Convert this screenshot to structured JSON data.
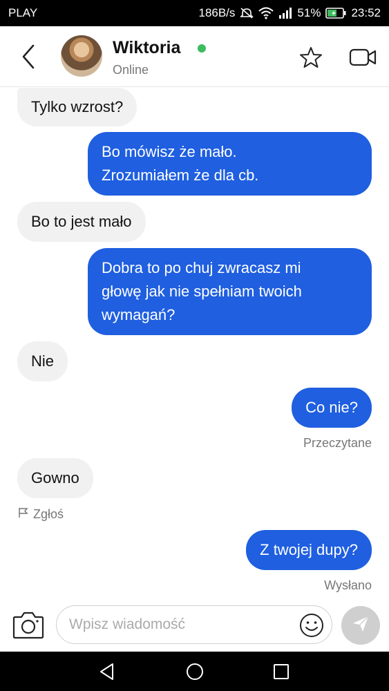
{
  "status_bar": {
    "carrier": "PLAY",
    "speed": "186B/s",
    "battery": "51%",
    "time": "23:52"
  },
  "header": {
    "contact_name": "Wiktoria",
    "contact_status": "Online",
    "online_color": "#3dbb5e",
    "icons": [
      "back-arrow-icon",
      "star-icon",
      "video-camera-icon"
    ]
  },
  "messages": [
    {
      "from": "them",
      "text": "Tylko wzrost?"
    },
    {
      "from": "me",
      "lines": [
        "Bo mówisz że mało.",
        "Zrozumiałem że dla cb."
      ]
    },
    {
      "from": "them",
      "text": "Bo to jest mało"
    },
    {
      "from": "me",
      "lines": [
        "Dobra to po chuj zwracasz mi",
        "głowę jak nie spełniam twoich",
        "wymagań?"
      ]
    },
    {
      "from": "them",
      "text": "Nie"
    },
    {
      "from": "me",
      "text": "Co nie?",
      "status": "Przeczytane"
    },
    {
      "from": "them",
      "text": "Gowno",
      "action": "Zgłoś"
    },
    {
      "from": "me",
      "text": "Z twojej dupy?",
      "status": "Wysłano"
    }
  ],
  "colors": {
    "outgoing_bubble": "#1f5fe0",
    "incoming_bubble": "#f1f1f1"
  },
  "composer": {
    "placeholder": "Wpisz wiadomość",
    "value": ""
  }
}
